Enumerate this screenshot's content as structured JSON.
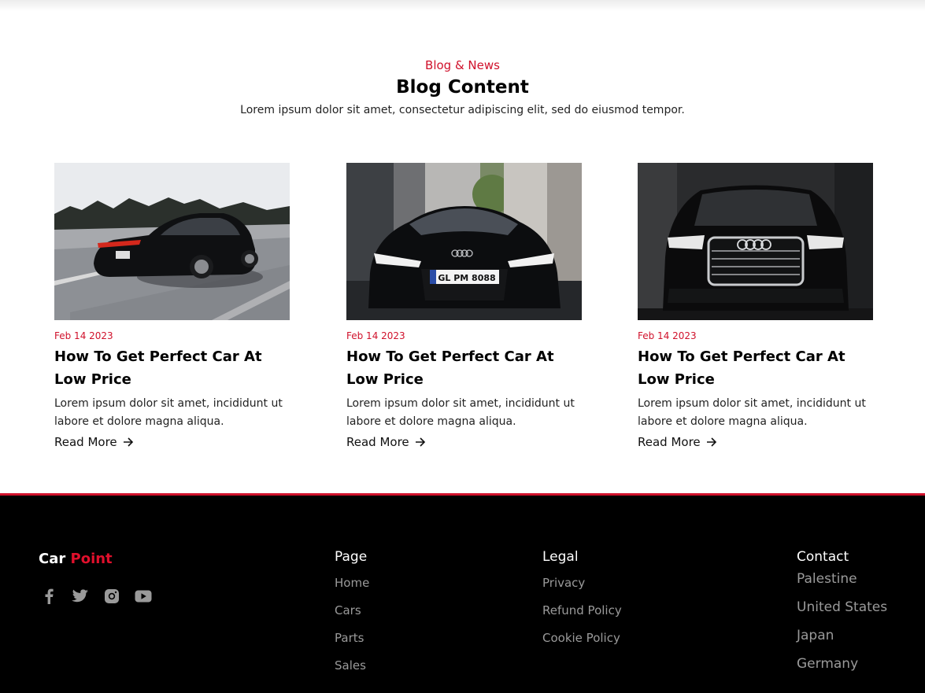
{
  "blog": {
    "eyebrow": "Blog & News",
    "title": "Blog Content",
    "subtitle": "Lorem ipsum dolor sit amet, consectetur adipiscing elit, sed do eiusmod tempor."
  },
  "posts": [
    {
      "image": "porsche-on-highway",
      "date": "Feb 14 2023",
      "title": "How To Get Perfect Car At Low Price",
      "excerpt": "Lorem ipsum dolor sit amet, incididunt ut labore et dolore magna aliqua.",
      "read_more": "Read More",
      "plate": ""
    },
    {
      "image": "audi-r8-front-street",
      "date": "Feb 14 2023",
      "title": "How To Get Perfect Car At Low Price",
      "excerpt": "Lorem ipsum dolor sit amet, incididunt ut labore et dolore magna aliqua.",
      "read_more": "Read More",
      "plate": "GL PM 8088"
    },
    {
      "image": "audi-a8-front-dark",
      "date": "Feb 14 2023",
      "title": "How To Get Perfect Car At Low Price",
      "excerpt": "Lorem ipsum dolor sit amet, incididunt ut labore et dolore magna aliqua.",
      "read_more": "Read More",
      "plate": ""
    }
  ],
  "footer": {
    "brand_first": "Car",
    "brand_second": "Point",
    "socials": [
      "facebook-icon",
      "twitter-icon",
      "instagram-icon",
      "youtube-icon"
    ],
    "page": {
      "heading": "Page",
      "links": [
        "Home",
        "Cars",
        "Parts",
        "Sales"
      ]
    },
    "legal": {
      "heading": "Legal",
      "links": [
        "Privacy",
        "Refund Policy",
        "Cookie Policy"
      ]
    },
    "contact": {
      "heading": "Contact",
      "links": [
        "Palestine",
        "United States",
        "Japan",
        "Germany"
      ]
    }
  },
  "colors": {
    "accent": "#d0112b",
    "footer_bg": "#000000",
    "footer_link": "#9a9a9a"
  }
}
